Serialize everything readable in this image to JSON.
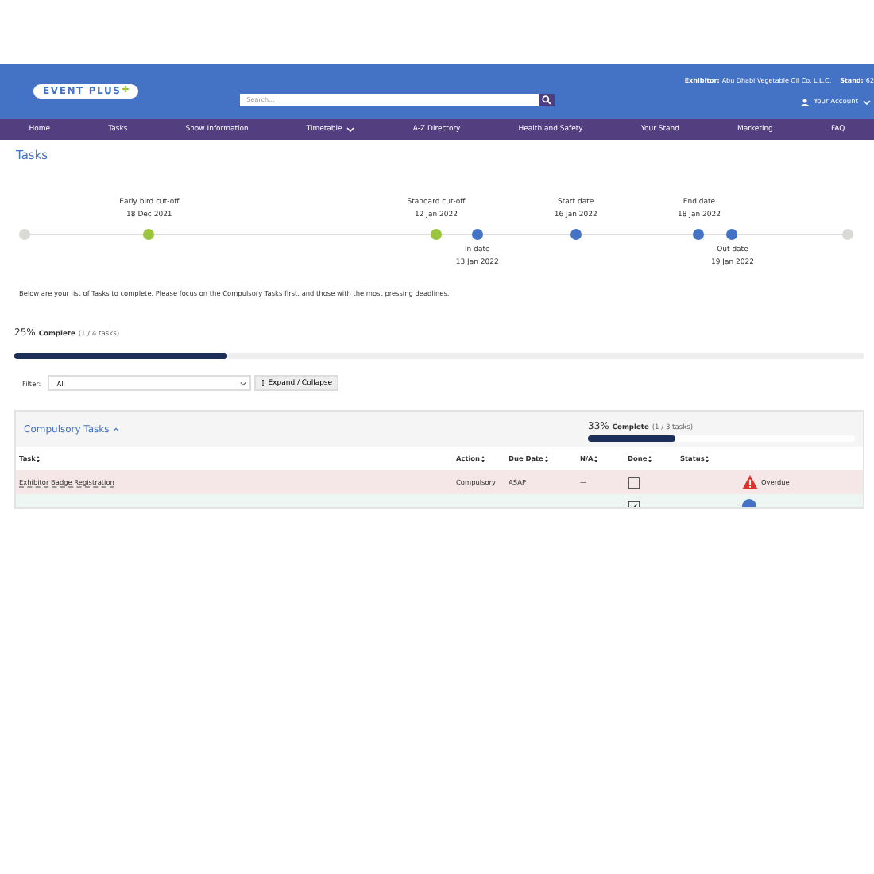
{
  "header": {
    "logo": "EVENT PLUS",
    "search": {
      "placeholder": "Search..."
    },
    "exhibitor_label": "Exhibitor:",
    "exhibitor": "Abu Dhabi Vegetable Oil Co. L.L.C.",
    "stand_label": "Stand:",
    "stand": "62",
    "account": "Your Account"
  },
  "nav": [
    {
      "label": "Home",
      "dropdown": false
    },
    {
      "label": "Tasks",
      "dropdown": false
    },
    {
      "label": "Show Information",
      "dropdown": false
    },
    {
      "label": "Timetable",
      "dropdown": true
    },
    {
      "label": "A-Z Directory",
      "dropdown": false
    },
    {
      "label": "Health and Safety",
      "dropdown": false
    },
    {
      "label": "Your Stand",
      "dropdown": false
    },
    {
      "label": "Marketing",
      "dropdown": false
    },
    {
      "label": "FAQ",
      "dropdown": false
    }
  ],
  "page_title": "Tasks",
  "timeline": [
    {
      "kind": "end"
    },
    {
      "kind": "cutoff",
      "label_above": {
        "title": "Early bird cut-off",
        "date": "18 Dec 2021"
      }
    },
    {
      "kind": "cutoff",
      "label_above": {
        "title": "Standard cut-off",
        "date": "12 Jan 2022"
      }
    },
    {
      "kind": "date",
      "label_below": {
        "title": "In date",
        "date": "13 Jan 2022"
      }
    },
    {
      "kind": "date",
      "label_above": {
        "title": "Start date",
        "date": "16 Jan 2022"
      }
    },
    {
      "kind": "date",
      "label_above": {
        "title": "End date",
        "date": "18 Jan 2022"
      }
    },
    {
      "kind": "date",
      "label_below": {
        "title": "Out date",
        "date": "19 Jan 2022"
      }
    },
    {
      "kind": "end"
    }
  ],
  "intro": "Below are your list of Tasks to complete. Please focus on the Compulsory Tasks first, and those with the most pressing deadlines.",
  "overall": {
    "percent": "25%",
    "label": "Complete",
    "count": "(1 / 4 tasks)",
    "level": 0.25
  },
  "filter": {
    "label": "Filter:",
    "value": "All",
    "button": "Expand / Collapse"
  },
  "section": {
    "title": "Compulsory Tasks",
    "expanded": true,
    "percent": "33%",
    "label": "Complete",
    "count": "(1 / 3 tasks)",
    "level": 0.33,
    "columns": [
      "Task",
      "Action",
      "Due Date",
      "N/A",
      "Done",
      "Status"
    ],
    "rows": [
      {
        "task": "Exhibitor Badge Registration",
        "action": "Compulsory",
        "due": "ASAP",
        "na": "—",
        "done": false,
        "status": "Overdue",
        "overdue": true
      },
      {
        "done": true,
        "overdue": false
      }
    ]
  }
}
